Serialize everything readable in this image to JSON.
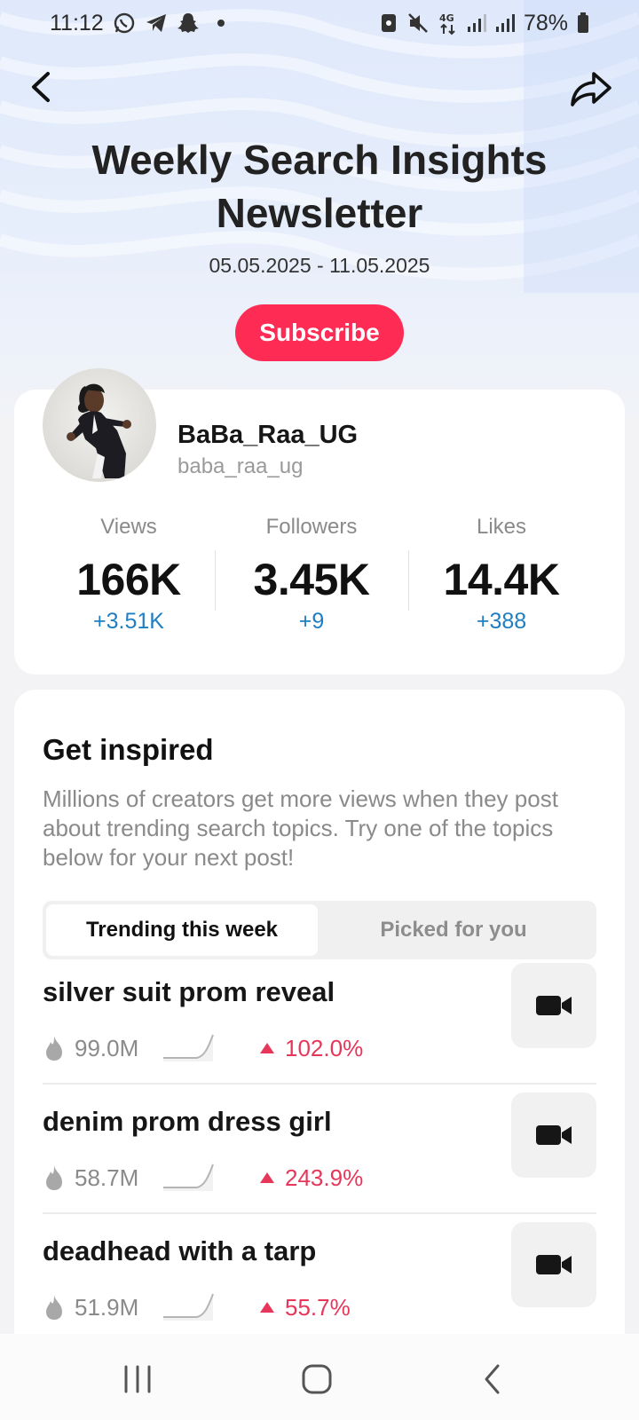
{
  "status": {
    "time": "11:12",
    "battery": "78%",
    "network": "4G",
    "icons": [
      "whatsapp-icon",
      "telegram-icon",
      "snapchat-icon",
      "dot-icon",
      "nfc-icon",
      "mute-icon",
      "4g-icon",
      "signal-icon",
      "signal-icon",
      "battery-icon"
    ]
  },
  "header": {
    "back_icon": "chevron-left-icon",
    "share_icon": "share-arrow-icon",
    "title": "Weekly Search Insights Newsletter",
    "date_range": "05.05.2025 - 11.05.2025",
    "subscribe_label": "Subscribe"
  },
  "profile": {
    "name": "BaBa_Raa_UG",
    "handle": "baba_raa_ug",
    "stats": [
      {
        "label": "Views",
        "value": "166K",
        "delta": "+3.51K"
      },
      {
        "label": "Followers",
        "value": "3.45K",
        "delta": "+9"
      },
      {
        "label": "Likes",
        "value": "14.4K",
        "delta": "+388"
      }
    ]
  },
  "inspire": {
    "title": "Get inspired",
    "description": "Millions of creators get more views when they post about trending search topics. Try one of the topics below for your next post!",
    "tabs": [
      {
        "label": "Trending this week",
        "active": true
      },
      {
        "label": "Picked for you",
        "active": false
      }
    ],
    "topics": [
      {
        "title": "silver suit prom reveal",
        "count": "99.0M",
        "growth": "102.0%"
      },
      {
        "title": "denim prom dress girl",
        "count": "58.7M",
        "growth": "243.9%"
      },
      {
        "title": "deadhead with a tarp",
        "count": "51.9M",
        "growth": "55.7%"
      }
    ]
  },
  "colors": {
    "accent": "#fe2c55",
    "delta_blue": "#1f7ec2",
    "growth_red": "#e6375b"
  },
  "navbar": {
    "icons": [
      "recent-apps-icon",
      "home-icon",
      "back-icon"
    ]
  }
}
